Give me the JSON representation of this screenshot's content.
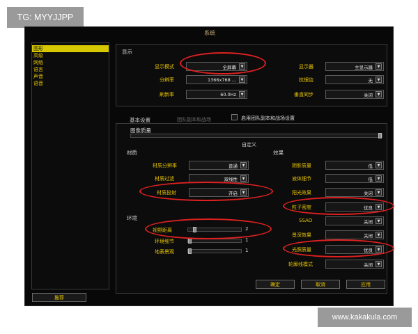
{
  "watermarks": {
    "top": "TG: MYYJJPP",
    "bottom": "www.kakakula.com"
  },
  "window": {
    "title": "系统"
  },
  "sidebar": {
    "categories": [
      "图形",
      "高级",
      "网络",
      "语言",
      "声音",
      "语音"
    ],
    "selected_index": 0,
    "recommend_label": "推荐"
  },
  "display": {
    "header": "显示",
    "mode_label": "显示模式",
    "mode_value": "全屏幕",
    "resolution_label": "分辨率",
    "resolution_value": "1366x768 ...",
    "refresh_label": "刷新率",
    "refresh_value": "60.0Hz",
    "monitor_label": "显示器",
    "monitor_value": "主显示器",
    "aa_label": "抗锯齿",
    "aa_value": "无",
    "vsync_label": "垂直同步",
    "vsync_value": "关闭"
  },
  "tabs": {
    "basic": "基本设置",
    "raid": "团队副本和战场",
    "raid_checkbox_label": "启用团队副本和战场设置"
  },
  "quality": {
    "label": "图像质量",
    "preset_label": "自定义",
    "slider_fraction": 1.0
  },
  "texture": {
    "header": "材质",
    "resolution_label": "材质分辨率",
    "resolution_value": "普通",
    "filter_label": "材质过滤",
    "filter_value": "双线性",
    "projection_label": "材质投射",
    "projection_value": "开启"
  },
  "environment": {
    "header": "环境",
    "view_distance_label": "视野距离",
    "view_distance_value": "2",
    "view_distance_fraction": 0.1,
    "env_detail_label": "环境细节",
    "env_detail_value": "1",
    "env_detail_fraction": 0.0,
    "ground_clutter_label": "地表景观",
    "ground_clutter_value": "1",
    "ground_clutter_fraction": 0.0
  },
  "effects": {
    "header": "效果",
    "shadow_label": "阴影质量",
    "shadow_value": "低",
    "liquid_label": "液体细节",
    "liquid_value": "低",
    "sunshafts_label": "阳光效果",
    "sunshafts_value": "关闭",
    "particle_label": "粒子密度",
    "particle_value": "优良",
    "ssao_label": "SSAO",
    "ssao_value": "关闭",
    "refraction_label": "景深效果",
    "refraction_value": "关闭",
    "lighting_label": "光照质量",
    "lighting_value": "优良",
    "outline_label": "轮廓线模式",
    "outline_value": "关闭"
  },
  "buttons": {
    "ok": "确定",
    "cancel": "取消",
    "apply": "应用"
  },
  "colors": {
    "accent_yellow": "#e6c300",
    "highlight_red": "#e02020",
    "background": "#080808"
  }
}
